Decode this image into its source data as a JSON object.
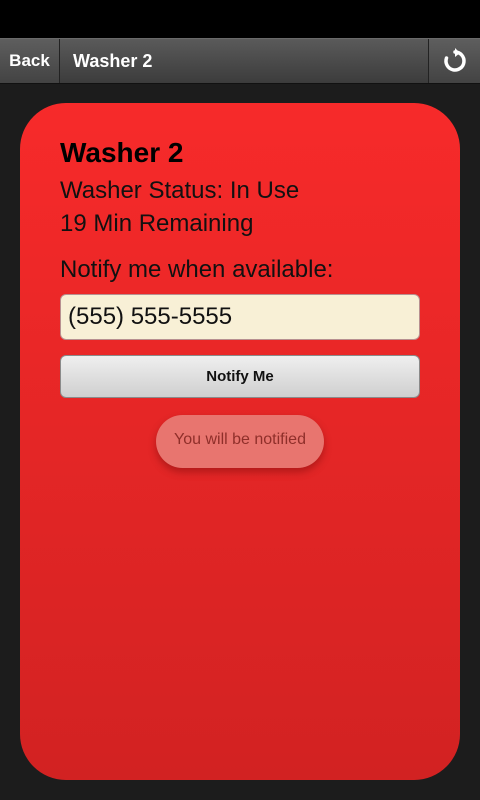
{
  "header": {
    "back_label": "Back",
    "title": "Washer 2",
    "refresh_icon": "refresh-icon"
  },
  "card": {
    "title": "Washer 2",
    "status": "Washer Status: In Use",
    "remaining": "19 Min Remaining",
    "notify_label": "Notify me when available:",
    "phone_value": "(555) 555-5555",
    "notify_button": "Notify Me",
    "toast": "You will be notified"
  },
  "colors": {
    "card_top": "#f72a2a",
    "card_bottom": "#d22222",
    "background": "#1c1c1c",
    "input_bg": "#f8f0d6"
  }
}
